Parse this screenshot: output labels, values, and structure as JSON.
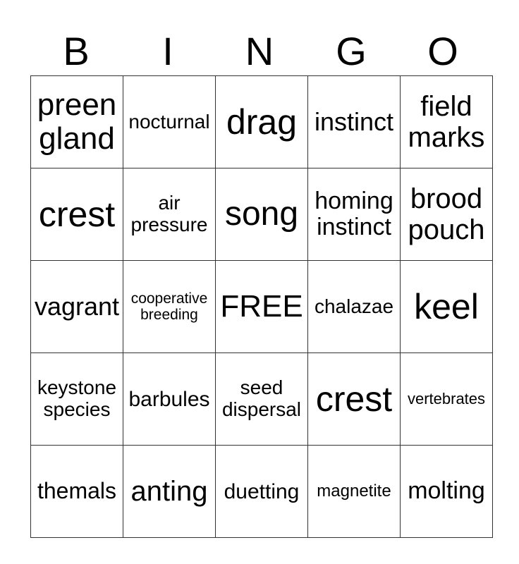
{
  "header": [
    "B",
    "I",
    "N",
    "G",
    "O"
  ],
  "rows": [
    [
      {
        "text": "preen gland",
        "size": 44
      },
      {
        "text": "nocturnal",
        "size": 28
      },
      {
        "text": "drag",
        "size": 50
      },
      {
        "text": "instinct",
        "size": 36
      },
      {
        "text": "field marks",
        "size": 40
      }
    ],
    [
      {
        "text": "crest",
        "size": 50
      },
      {
        "text": "air pressure",
        "size": 28
      },
      {
        "text": "song",
        "size": 48
      },
      {
        "text": "homing instinct",
        "size": 34
      },
      {
        "text": "brood pouch",
        "size": 40
      }
    ],
    [
      {
        "text": "vagrant",
        "size": 36
      },
      {
        "text": "cooperative breeding",
        "size": 21
      },
      {
        "text": "FREE",
        "size": 44
      },
      {
        "text": "chalazae",
        "size": 28
      },
      {
        "text": "keel",
        "size": 50
      }
    ],
    [
      {
        "text": "keystone species",
        "size": 28
      },
      {
        "text": "barbules",
        "size": 30
      },
      {
        "text": "seed dispersal",
        "size": 28
      },
      {
        "text": "crest",
        "size": 50
      },
      {
        "text": "vertebrates",
        "size": 22
      }
    ],
    [
      {
        "text": "themals",
        "size": 32
      },
      {
        "text": "anting",
        "size": 40
      },
      {
        "text": "duetting",
        "size": 30
      },
      {
        "text": "magnetite",
        "size": 24
      },
      {
        "text": "molting",
        "size": 34
      }
    ]
  ]
}
